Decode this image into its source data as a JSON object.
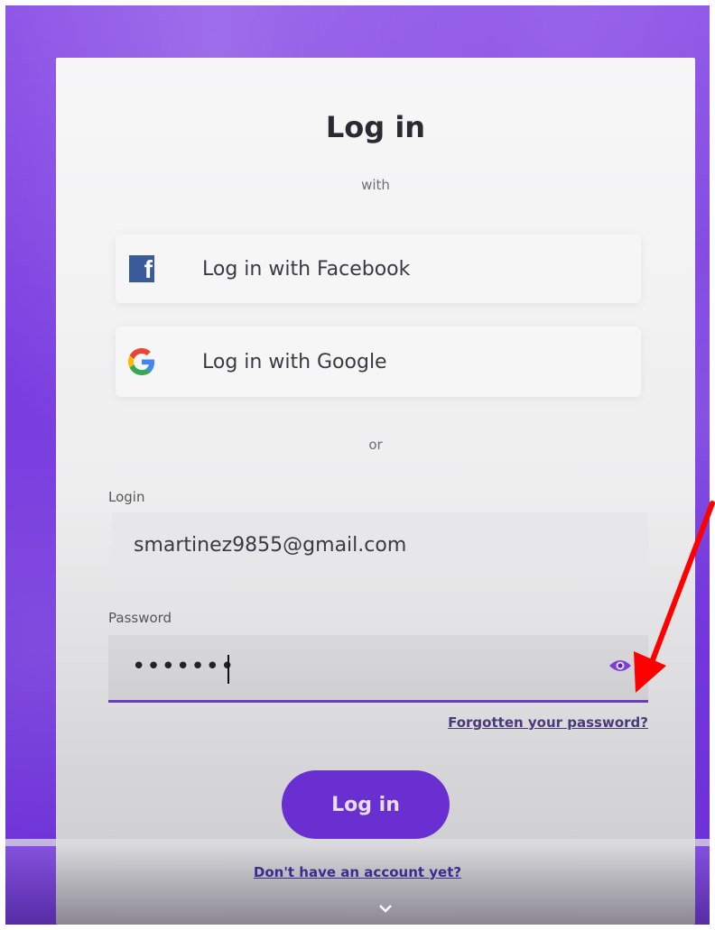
{
  "login_card": {
    "title": "Log in",
    "subtitle": "with",
    "facebook_label": "Log in with Facebook",
    "google_label": "Log in with Google",
    "separator": "or",
    "login_label": "Login",
    "login_value": "smartinez9855@gmail.com",
    "password_label": "Password",
    "password_value": "•••••••",
    "forgot_link": "Forgotten your password?",
    "submit_label": "Log in",
    "signup_link": "Don't have an account yet?"
  },
  "colors": {
    "brand_purple": "#7b3fe0",
    "button_purple": "#6a2fd0",
    "facebook_blue": "#3b5a9a",
    "annotation_red": "#ff0000"
  },
  "icons": [
    "facebook-icon",
    "google-icon",
    "eye-icon",
    "chevron-down-icon"
  ]
}
